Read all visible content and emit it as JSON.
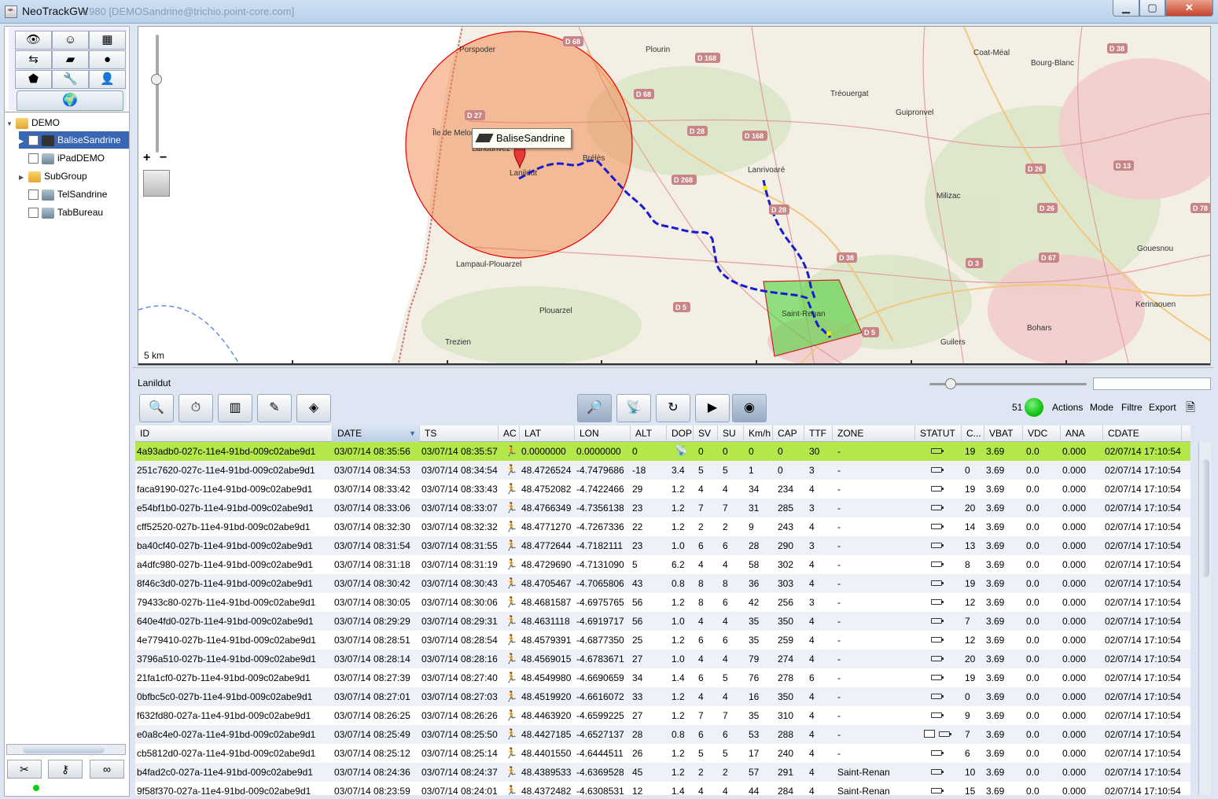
{
  "window": {
    "title": "NeoTrackGW",
    "subtitle": "v.980 [DEMOSandrine@trichio.point-core.com]",
    "minimize": "▁",
    "maximize": "▢",
    "close": "✕"
  },
  "sidebar": {
    "tree": [
      {
        "label": "DEMO"
      },
      {
        "label": "BaliseSandrine",
        "checked": true
      },
      {
        "label": "iPadDEMO"
      },
      {
        "label": "SubGroup"
      },
      {
        "label": "TelSandrine"
      },
      {
        "label": "TabBureau"
      }
    ],
    "checkmark": "✓"
  },
  "map": {
    "scale_label": "5 km",
    "popup_label": "BaliseSandrine",
    "places": [
      {
        "name": "Porspoder"
      },
      {
        "name": "Plourin"
      },
      {
        "name": "Coat-Méal"
      },
      {
        "name": "Tréouergat"
      },
      {
        "name": "Bourg-Blanc"
      },
      {
        "name": "Guipronvel"
      },
      {
        "name": "Île de Melon"
      },
      {
        "name": "Landunvez"
      },
      {
        "name": "Lanildut"
      },
      {
        "name": "Brélès"
      },
      {
        "name": "Lanrivoaré"
      },
      {
        "name": "Milizac"
      },
      {
        "name": "Gouesnou"
      },
      {
        "name": "Lampaul-Plouarzel"
      },
      {
        "name": "Plouarzel"
      },
      {
        "name": "Saint-Renan"
      },
      {
        "name": "Kerinaouen"
      },
      {
        "name": "Bohars"
      },
      {
        "name": "Trezien"
      },
      {
        "name": "Guilers"
      }
    ],
    "roads": [
      "D 68",
      "D 168",
      "D 38",
      "D 27",
      "D 68",
      "D 168",
      "D 28",
      "D 26",
      "D 13",
      "D 268",
      "D 28",
      "D 26",
      "D 78",
      "D 38",
      "D 67",
      "D 3",
      "D 5",
      "D 5"
    ]
  },
  "bottom": {
    "label": "Lanildut",
    "count": "51",
    "menu": {
      "actions": "Actions",
      "mode": "Mode",
      "filter": "Filtre",
      "export": "Export"
    }
  },
  "table": {
    "columns": [
      "ID",
      "DATE",
      "TS",
      "AC",
      "LAT",
      "LON",
      "ALT",
      "DOP",
      "SV",
      "SU",
      "Km/h",
      "CAP",
      "TTF",
      "ZONE",
      "STATUT",
      "C...",
      "VBAT",
      "VDC",
      "ANA",
      "CDATE"
    ],
    "rows": [
      {
        "id": "4a93adb0-027c-11e4-91bd-009c02abe9d1",
        "date": "03/07/14 08:35:56",
        "ts": "03/07/14 08:35:57",
        "lat": "0.0000000",
        "lon": "0.0000000",
        "alt": "0",
        "dop": "",
        "sv": "0",
        "su": "0",
        "kmh": "0",
        "cap": "0",
        "ttf": "30",
        "zone": "-",
        "c": "19",
        "vbat": "3.69",
        "vdc": "0.0",
        "ana": "0.000",
        "cdate": "02/07/14 17:10:54"
      },
      {
        "id": "251c7620-027c-11e4-91bd-009c02abe9d1",
        "date": "03/07/14 08:34:53",
        "ts": "03/07/14 08:34:54",
        "lat": "48.4726524",
        "lon": "-4.7479686",
        "alt": "-18",
        "dop": "3.4",
        "sv": "5",
        "su": "5",
        "kmh": "1",
        "cap": "0",
        "ttf": "3",
        "zone": "-",
        "c": "0",
        "vbat": "3.69",
        "vdc": "0.0",
        "ana": "0.000",
        "cdate": "02/07/14 17:10:54"
      },
      {
        "id": "faca9190-027c-11e4-91bd-009c02abe9d1",
        "date": "03/07/14 08:33:42",
        "ts": "03/07/14 08:33:43",
        "lat": "48.4752082",
        "lon": "-4.7422466",
        "alt": "29",
        "dop": "1.2",
        "sv": "4",
        "su": "4",
        "kmh": "34",
        "cap": "234",
        "ttf": "4",
        "zone": "-",
        "c": "19",
        "vbat": "3.69",
        "vdc": "0.0",
        "ana": "0.000",
        "cdate": "02/07/14 17:10:54"
      },
      {
        "id": "e54bf1b0-027b-11e4-91bd-009c02abe9d1",
        "date": "03/07/14 08:33:06",
        "ts": "03/07/14 08:33:07",
        "lat": "48.4766349",
        "lon": "-4.7356138",
        "alt": "23",
        "dop": "1.2",
        "sv": "7",
        "su": "7",
        "kmh": "31",
        "cap": "285",
        "ttf": "3",
        "zone": "-",
        "c": "20",
        "vbat": "3.69",
        "vdc": "0.0",
        "ana": "0.000",
        "cdate": "02/07/14 17:10:54"
      },
      {
        "id": "cff52520-027b-11e4-91bd-009c02abe9d1",
        "date": "03/07/14 08:32:30",
        "ts": "03/07/14 08:32:32",
        "lat": "48.4771270",
        "lon": "-4.7267336",
        "alt": "22",
        "dop": "1.2",
        "sv": "2",
        "su": "2",
        "kmh": "9",
        "cap": "243",
        "ttf": "4",
        "zone": "-",
        "c": "14",
        "vbat": "3.69",
        "vdc": "0.0",
        "ana": "0.000",
        "cdate": "02/07/14 17:10:54"
      },
      {
        "id": "ba40cf40-027b-11e4-91bd-009c02abe9d1",
        "date": "03/07/14 08:31:54",
        "ts": "03/07/14 08:31:55",
        "lat": "48.4772644",
        "lon": "-4.7182111",
        "alt": "23",
        "dop": "1.0",
        "sv": "6",
        "su": "6",
        "kmh": "28",
        "cap": "290",
        "ttf": "3",
        "zone": "-",
        "c": "13",
        "vbat": "3.69",
        "vdc": "0.0",
        "ana": "0.000",
        "cdate": "02/07/14 17:10:54"
      },
      {
        "id": "a4dfc980-027b-11e4-91bd-009c02abe9d1",
        "date": "03/07/14 08:31:18",
        "ts": "03/07/14 08:31:19",
        "lat": "48.4729690",
        "lon": "-4.7131090",
        "alt": "5",
        "dop": "6.2",
        "sv": "4",
        "su": "4",
        "kmh": "58",
        "cap": "302",
        "ttf": "4",
        "zone": "-",
        "c": "8",
        "vbat": "3.69",
        "vdc": "0.0",
        "ana": "0.000",
        "cdate": "02/07/14 17:10:54"
      },
      {
        "id": "8f46c3d0-027b-11e4-91bd-009c02abe9d1",
        "date": "03/07/14 08:30:42",
        "ts": "03/07/14 08:30:43",
        "lat": "48.4705467",
        "lon": "-4.7065806",
        "alt": "43",
        "dop": "0.8",
        "sv": "8",
        "su": "8",
        "kmh": "36",
        "cap": "303",
        "ttf": "4",
        "zone": "-",
        "c": "19",
        "vbat": "3.69",
        "vdc": "0.0",
        "ana": "0.000",
        "cdate": "02/07/14 17:10:54"
      },
      {
        "id": "79433c80-027b-11e4-91bd-009c02abe9d1",
        "date": "03/07/14 08:30:05",
        "ts": "03/07/14 08:30:06",
        "lat": "48.4681587",
        "lon": "-4.6975765",
        "alt": "56",
        "dop": "1.2",
        "sv": "8",
        "su": "6",
        "kmh": "42",
        "cap": "256",
        "ttf": "3",
        "zone": "-",
        "c": "12",
        "vbat": "3.69",
        "vdc": "0.0",
        "ana": "0.000",
        "cdate": "02/07/14 17:10:54"
      },
      {
        "id": "640e4fd0-027b-11e4-91bd-009c02abe9d1",
        "date": "03/07/14 08:29:29",
        "ts": "03/07/14 08:29:31",
        "lat": "48.4631118",
        "lon": "-4.6919717",
        "alt": "56",
        "dop": "1.0",
        "sv": "4",
        "su": "4",
        "kmh": "35",
        "cap": "350",
        "ttf": "4",
        "zone": "-",
        "c": "7",
        "vbat": "3.69",
        "vdc": "0.0",
        "ana": "0.000",
        "cdate": "02/07/14 17:10:54"
      },
      {
        "id": "4e779410-027b-11e4-91bd-009c02abe9d1",
        "date": "03/07/14 08:28:51",
        "ts": "03/07/14 08:28:54",
        "lat": "48.4579391",
        "lon": "-4.6877350",
        "alt": "25",
        "dop": "1.2",
        "sv": "6",
        "su": "6",
        "kmh": "35",
        "cap": "259",
        "ttf": "4",
        "zone": "-",
        "c": "12",
        "vbat": "3.69",
        "vdc": "0.0",
        "ana": "0.000",
        "cdate": "02/07/14 17:10:54"
      },
      {
        "id": "3796a510-027b-11e4-91bd-009c02abe9d1",
        "date": "03/07/14 08:28:14",
        "ts": "03/07/14 08:28:16",
        "lat": "48.4569015",
        "lon": "-4.6783671",
        "alt": "27",
        "dop": "1.0",
        "sv": "4",
        "su": "4",
        "kmh": "79",
        "cap": "274",
        "ttf": "4",
        "zone": "-",
        "c": "20",
        "vbat": "3.69",
        "vdc": "0.0",
        "ana": "0.000",
        "cdate": "02/07/14 17:10:54"
      },
      {
        "id": "21fa1cf0-027b-11e4-91bd-009c02abe9d1",
        "date": "03/07/14 08:27:39",
        "ts": "03/07/14 08:27:40",
        "lat": "48.4549980",
        "lon": "-4.6690659",
        "alt": "34",
        "dop": "1.4",
        "sv": "6",
        "su": "5",
        "kmh": "76",
        "cap": "278",
        "ttf": "6",
        "zone": "-",
        "c": "19",
        "vbat": "3.69",
        "vdc": "0.0",
        "ana": "0.000",
        "cdate": "02/07/14 17:10:54"
      },
      {
        "id": "0bfbc5c0-027b-11e4-91bd-009c02abe9d1",
        "date": "03/07/14 08:27:01",
        "ts": "03/07/14 08:27:03",
        "lat": "48.4519920",
        "lon": "-4.6616072",
        "alt": "33",
        "dop": "1.2",
        "sv": "4",
        "su": "4",
        "kmh": "16",
        "cap": "350",
        "ttf": "4",
        "zone": "-",
        "c": "0",
        "vbat": "3.69",
        "vdc": "0.0",
        "ana": "0.000",
        "cdate": "02/07/14 17:10:54"
      },
      {
        "id": "f632fd80-027a-11e4-91bd-009c02abe9d1",
        "date": "03/07/14 08:26:25",
        "ts": "03/07/14 08:26:26",
        "lat": "48.4463920",
        "lon": "-4.6599225",
        "alt": "27",
        "dop": "1.2",
        "sv": "7",
        "su": "7",
        "kmh": "35",
        "cap": "310",
        "ttf": "4",
        "zone": "-",
        "c": "9",
        "vbat": "3.69",
        "vdc": "0.0",
        "ana": "0.000",
        "cdate": "02/07/14 17:10:54"
      },
      {
        "id": "e0a8c4e0-027a-11e4-91bd-009c02abe9d1",
        "date": "03/07/14 08:25:49",
        "ts": "03/07/14 08:25:50",
        "lat": "48.4427185",
        "lon": "-4.6527137",
        "alt": "28",
        "dop": "0.8",
        "sv": "6",
        "su": "6",
        "kmh": "53",
        "cap": "288",
        "ttf": "4",
        "zone": "-",
        "c": "7",
        "vbat": "3.69",
        "vdc": "0.0",
        "ana": "0.000",
        "cdate": "02/07/14 17:10:54",
        "mail": true
      },
      {
        "id": "cb5812d0-027a-11e4-91bd-009c02abe9d1",
        "date": "03/07/14 08:25:12",
        "ts": "03/07/14 08:25:14",
        "lat": "48.4401550",
        "lon": "-4.6444511",
        "alt": "26",
        "dop": "1.2",
        "sv": "5",
        "su": "5",
        "kmh": "17",
        "cap": "240",
        "ttf": "4",
        "zone": "-",
        "c": "6",
        "vbat": "3.69",
        "vdc": "0.0",
        "ana": "0.000",
        "cdate": "02/07/14 17:10:54"
      },
      {
        "id": "b4fad2c0-027a-11e4-91bd-009c02abe9d1",
        "date": "03/07/14 08:24:36",
        "ts": "03/07/14 08:24:37",
        "lat": "48.4389533",
        "lon": "-4.6369528",
        "alt": "45",
        "dop": "1.2",
        "sv": "2",
        "su": "2",
        "kmh": "57",
        "cap": "291",
        "ttf": "4",
        "zone": "Saint-Renan",
        "c": "10",
        "vbat": "3.69",
        "vdc": "0.0",
        "ana": "0.000",
        "cdate": "02/07/14 17:10:54"
      },
      {
        "id": "9f58f370-027a-11e4-91bd-009c02abe9d1",
        "date": "03/07/14 08:23:59",
        "ts": "03/07/14 08:24:01",
        "lat": "48.4372482",
        "lon": "-4.6308531",
        "alt": "12",
        "dop": "1.4",
        "sv": "4",
        "su": "4",
        "kmh": "44",
        "cap": "284",
        "ttf": "4",
        "zone": "Saint-Renan",
        "c": "15",
        "vbat": "3.69",
        "vdc": "0.0",
        "ana": "0.000",
        "cdate": "02/07/14 17:10:54"
      }
    ]
  },
  "colors": {
    "highlight_row": "#b4e74a",
    "selection": "#3a67b3",
    "track": "#1a1acf",
    "geofence": "#66cc44",
    "radius": "#f08040"
  }
}
